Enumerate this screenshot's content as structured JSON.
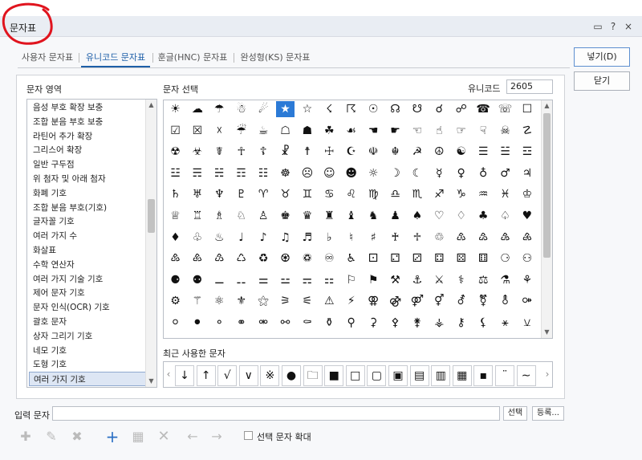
{
  "window": {
    "title": "문자표",
    "buttons": [
      "▭",
      "?",
      "×"
    ]
  },
  "tabs": [
    {
      "label": "사용자 문자표"
    },
    {
      "label": "유니코드 문자표"
    },
    {
      "label": "훈글(HNC) 문자표"
    },
    {
      "label": "완성형(KS) 문자표"
    }
  ],
  "area_label": "문자 영역",
  "select_label": "문자 선택",
  "unicode_label": "유니코드",
  "unicode_value": "2605",
  "area_list": [
    "음성 부호 확장 보충",
    "조합 분음 부호 보충",
    "라틴어 추가 확장",
    "그리스어 확장",
    "일반 구두점",
    "위 첨자 및 아래 첨자",
    "화폐 기호",
    "조합 분음 부호(기호)",
    "글자꼴 기호",
    "여러 가지 수",
    "화살표",
    "수학 연산자",
    "여러 가지 기술 기호",
    "제어 문자 기호",
    "문자 인식(OCR) 기호",
    "괄호 문자",
    "상자 그리기 기호",
    "네모 기호",
    "도형 기호",
    "여러 가지 기호"
  ],
  "selected_area_index": 19,
  "char_grid": [
    [
      "☀",
      "☁",
      "☂",
      "☃",
      "☄",
      "★",
      "☆",
      "☇",
      "☈",
      "☉",
      "☊",
      "☋",
      "☌",
      "☍",
      "☎",
      "☏",
      "☐"
    ],
    [
      "☑",
      "☒",
      "☓",
      "☔",
      "☕",
      "☖",
      "☗",
      "☘",
      "☙",
      "☚",
      "☛",
      "☜",
      "☝",
      "☞",
      "☟",
      "☠",
      "☡"
    ],
    [
      "☢",
      "☣",
      "☤",
      "☥",
      "☦",
      "☧",
      "☨",
      "☩",
      "☪",
      "☫",
      "☬",
      "☭",
      "☮",
      "☯",
      "☰",
      "☱",
      "☲"
    ],
    [
      "☳",
      "☴",
      "☵",
      "☶",
      "☷",
      "☸",
      "☹",
      "☺",
      "☻",
      "☼",
      "☽",
      "☾",
      "☿",
      "♀",
      "♁",
      "♂",
      "♃"
    ],
    [
      "♄",
      "♅",
      "♆",
      "♇",
      "♈",
      "♉",
      "♊",
      "♋",
      "♌",
      "♍",
      "♎",
      "♏",
      "♐",
      "♑",
      "♒",
      "♓",
      "♔"
    ],
    [
      "♕",
      "♖",
      "♗",
      "♘",
      "♙",
      "♚",
      "♛",
      "♜",
      "♝",
      "♞",
      "♟",
      "♠",
      "♡",
      "♢",
      "♣",
      "♤",
      "♥"
    ],
    [
      "♦",
      "♧",
      "♨",
      "♩",
      "♪",
      "♫",
      "♬",
      "♭",
      "♮",
      "♯",
      "♰",
      "♱",
      "♲",
      "♳",
      "♴",
      "♵",
      "♶"
    ],
    [
      "♷",
      "♸",
      "♹",
      "♺",
      "♻",
      "♼",
      "♽",
      "♾",
      "♿",
      "⚀",
      "⚁",
      "⚂",
      "⚃",
      "⚄",
      "⚅",
      "⚆",
      "⚇"
    ],
    [
      "⚈",
      "⚉",
      "⚊",
      "⚋",
      "⚌",
      "⚍",
      "⚎",
      "⚏",
      "⚐",
      "⚑",
      "⚒",
      "⚓",
      "⚔",
      "⚕",
      "⚖",
      "⚗",
      "⚘"
    ],
    [
      "⚙",
      "⚚",
      "⚛",
      "⚜",
      "⚝",
      "⚞",
      "⚟",
      "⚠",
      "⚡",
      "⚢",
      "⚣",
      "⚤",
      "⚥",
      "⚦",
      "⚧",
      "⚨",
      "⚩"
    ],
    [
      "⚪",
      "⚫",
      "⚬",
      "⚭",
      "⚮",
      "⚯",
      "⚰",
      "⚱",
      "⚲",
      "⚳",
      "⚴",
      "⚵",
      "⚶",
      "⚷",
      "⚸",
      "⚹",
      "⚺"
    ]
  ],
  "selected_char": {
    "row": 0,
    "col": 5
  },
  "recent_label": "최근 사용한 문자",
  "recent_chars": [
    "↓",
    "↑",
    "√",
    "∨",
    "※",
    "●",
    "🗀",
    "■",
    "□",
    "▢",
    "▣",
    "▤",
    "▥",
    "▦",
    "▪",
    "¨",
    "∼"
  ],
  "buttons": {
    "insert": "넣기(D)",
    "close": "닫기",
    "select": "선택",
    "register": "등록..."
  },
  "input_label": "입력 문자",
  "input_value": "",
  "toolbar_icons": [
    "add-char-icon",
    "edit-char-icon",
    "delete-char-icon",
    "add-icon",
    "add-table-icon",
    "delete-icon",
    "arrow-left-icon",
    "arrow-right-icon"
  ],
  "enlarge_label": "선택 문자 확대",
  "colors": {
    "accent": "#2b7ad6",
    "tab_active": "#1e5fa8",
    "annotation": "#e0141e"
  }
}
